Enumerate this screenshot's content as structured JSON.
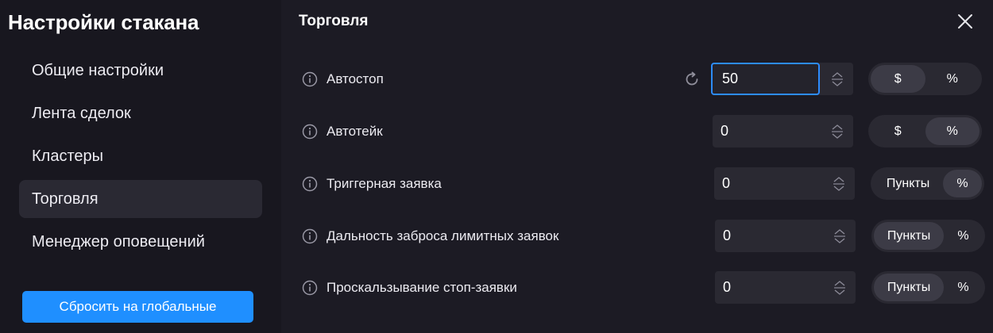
{
  "sidebar": {
    "title": "Настройки стакана",
    "items": [
      {
        "label": "Общие настройки"
      },
      {
        "label": "Лента сделок"
      },
      {
        "label": "Кластеры"
      },
      {
        "label": "Торговля"
      },
      {
        "label": "Менеджер оповещений"
      }
    ],
    "active_item": "Торговля",
    "reset_label": "Сбросить на глобальные"
  },
  "main": {
    "title": "Торговля",
    "rows": [
      {
        "label": "Автостоп",
        "value": "50",
        "options": [
          "$",
          "%"
        ],
        "selected": "$"
      },
      {
        "label": "Автотейк",
        "value": "0",
        "options": [
          "$",
          "%"
        ],
        "selected": "%"
      },
      {
        "label": "Триггерная заявка",
        "value": "0",
        "options": [
          "Пункты",
          "%"
        ],
        "selected": "%"
      },
      {
        "label": "Дальность заброса лимитных заявок",
        "value": "0",
        "options": [
          "Пункты",
          "%"
        ],
        "selected": "Пункты"
      },
      {
        "label": "Проскальзывание стоп-заявки",
        "value": "0",
        "options": [
          "Пункты",
          "%"
        ],
        "selected": "Пункты"
      }
    ]
  },
  "colors": {
    "accent": "#1f8fff",
    "focus_border": "#2d8cff",
    "background": "#1c1b24",
    "sidebar_background": "#18171f"
  },
  "icons": [
    "info-icon",
    "refresh-icon",
    "spinner-icon",
    "close-icon"
  ]
}
